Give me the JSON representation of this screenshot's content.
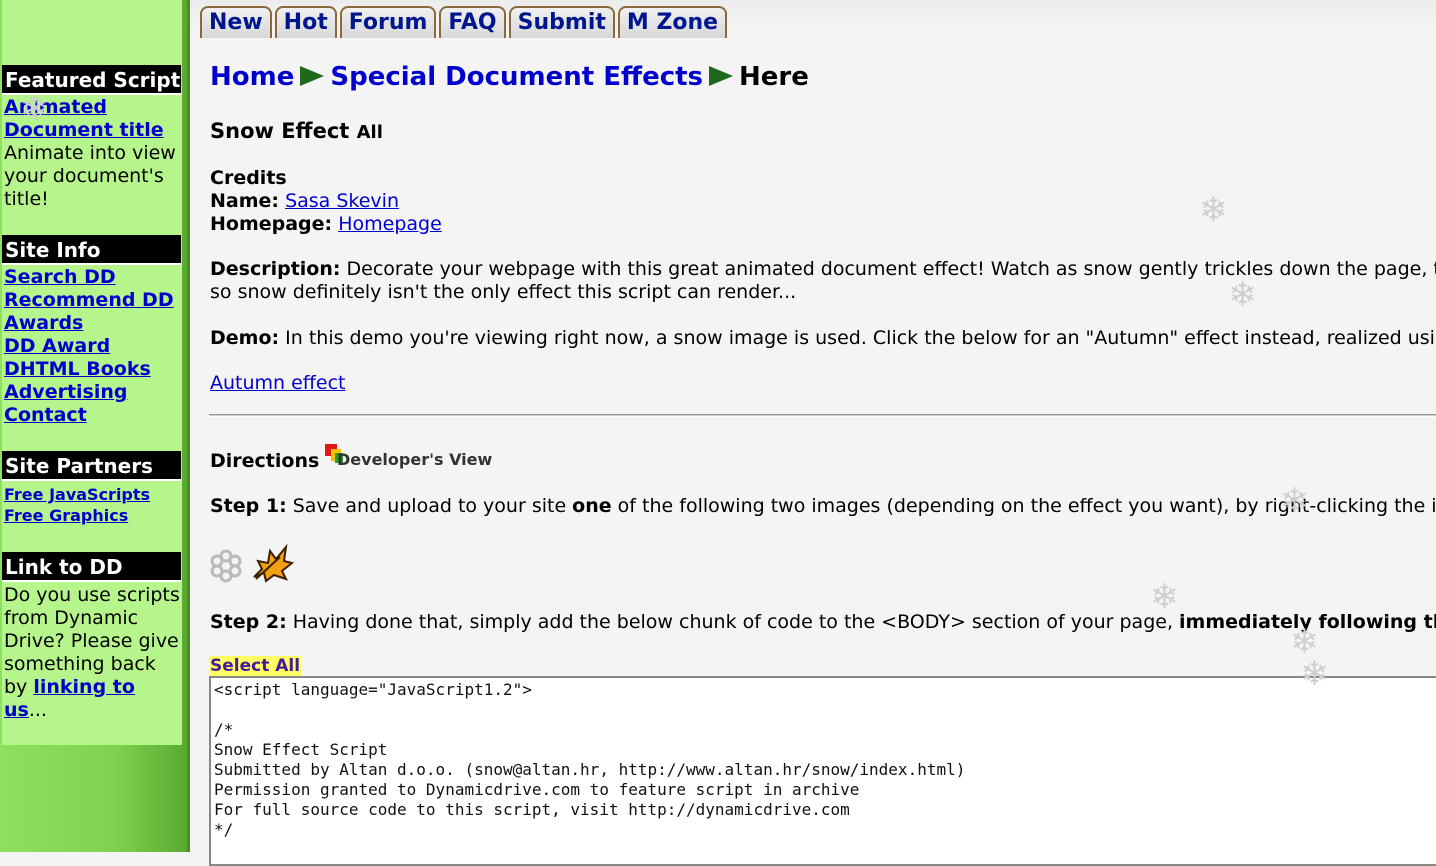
{
  "tabs": [
    "New",
    "Hot",
    "Forum",
    "FAQ",
    "Submit",
    "M Zone"
  ],
  "sidebar": {
    "featured": {
      "title": "Featured Script",
      "link_line1": "Animated",
      "link_line2": "Document title",
      "desc": [
        "Animate into view",
        "your document's",
        "title!"
      ]
    },
    "site_info": {
      "title": "Site Info",
      "links": [
        "Search DD",
        "Recommend DD",
        "Awards",
        "DD Award",
        "DHTML Books",
        "Advertising",
        "Contact"
      ]
    },
    "partners": {
      "title": "Site Partners",
      "links": [
        "Free JavaScripts",
        "Free Graphics"
      ]
    },
    "link_to_dd": {
      "title": "Link to DD",
      "text": [
        "Do you use scripts",
        "from Dynamic",
        "Drive? Please give",
        "something back"
      ],
      "by": "by ",
      "link_part1": "linking to",
      "link_part2": "us",
      "ellipsis": "..."
    }
  },
  "breadcrumb": {
    "home": "Home",
    "section": "Special Document Effects",
    "current": "Here"
  },
  "script": {
    "title": "Snow Effect",
    "title_suffix": "All",
    "credits_label": "Credits",
    "name_label": "Name:",
    "name_value": "Sasa Skevin",
    "homepage_label": "Homepage:",
    "homepage_value": "Homepage",
    "desc_label": "Description:",
    "desc_line1": " Decorate your webpage with this great animated document effect! Watch as snow gently trickles down the page, the",
    "desc_line2": "so snow definitely isn't the only effect this script can render...",
    "demo_label": "Demo:",
    "demo_text": " In this demo you're viewing right now, a snow image is used. Click the below for an \"Autumn\" effect instead, realized using",
    "autumn_link": "Autumn effect"
  },
  "directions": {
    "title": "Directions",
    "dev_view": "Developer's View",
    "step1_label": "Step 1:",
    "step1_pre": " Save and upload to your site ",
    "step1_bold": "one",
    "step1_post": " of the following two images (depending on the effect you want), by right-clicking the ima",
    "step2_label": "Step 2:",
    "step2_pre": " Having done that, simply add the below chunk of code to the <BODY> section of your page, ",
    "step2_bold": "immediately following the",
    "select_all": "Select All",
    "code": "<script language=\"JavaScript1.2\">\n\n/*\nSnow Effect Script\nSubmitted by Altan d.o.o. (snow@altan.hr, http://www.altan.hr/snow/index.html)\nPermission granted to Dynamicdrive.com to feature script in archive\nFor full source code to this script, visit http://dynamicdrive.com\n*/"
  },
  "colors": {
    "link": "#0000cc",
    "sidebar_bg": "#b6f58c",
    "tab_text": "#00168f"
  }
}
